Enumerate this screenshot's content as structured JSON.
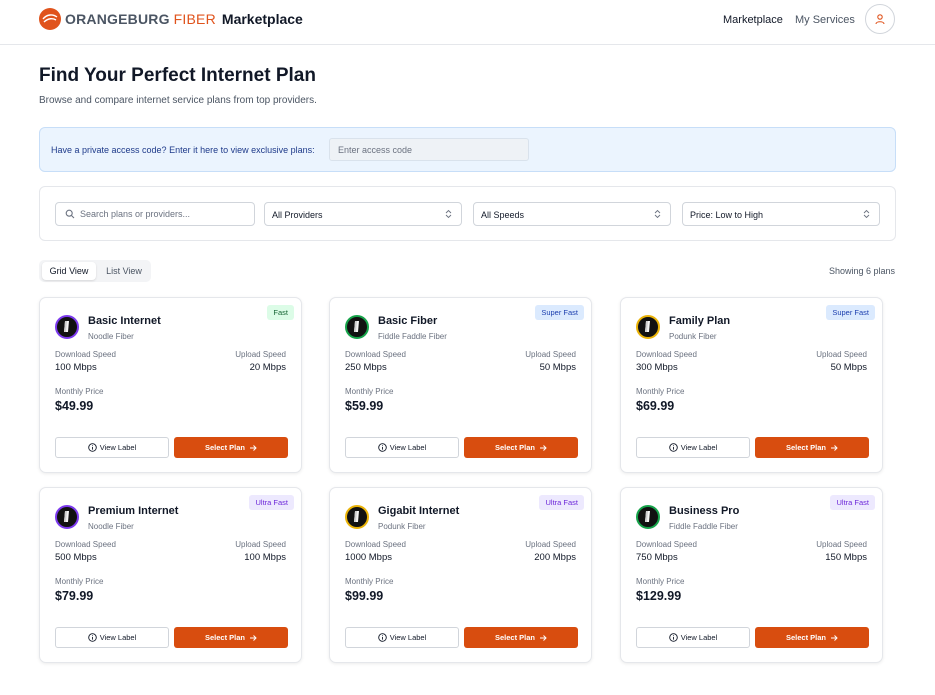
{
  "header": {
    "logo_word1": "ORANGEBURG",
    "logo_word2": "FIBER",
    "logo_word3": "Marketplace",
    "nav_marketplace": "Marketplace",
    "nav_services": "My Services",
    "brand_color": "#e0531c"
  },
  "main": {
    "title": "Find Your Perfect Internet Plan",
    "subtitle": "Browse and compare internet service plans from top providers."
  },
  "access": {
    "label": "Have a private access code? Enter it here to view exclusive plans:",
    "placeholder": "Enter access code"
  },
  "filters": {
    "search_placeholder": "Search plans or providers...",
    "provider": "All Providers",
    "speed": "All Speeds",
    "sort": "Price: Low to High"
  },
  "view": {
    "grid": "Grid View",
    "list": "List View",
    "showing": "Showing 6 plans"
  },
  "card_labels": {
    "download": "Download Speed",
    "upload": "Upload Speed",
    "monthly": "Monthly Price",
    "view_label": "View Label",
    "select": "Select Plan"
  },
  "plans": [
    {
      "name": "Basic Internet",
      "provider": "Noodle Fiber",
      "badge": "Fast",
      "badge_type": "fast",
      "ring": "#7c3aed",
      "download": "100 Mbps",
      "upload": "20 Mbps",
      "price": "$49.99"
    },
    {
      "name": "Basic Fiber",
      "provider": "Fiddle Faddle Fiber",
      "badge": "Super Fast",
      "badge_type": "super",
      "ring": "#16a34a",
      "download": "250 Mbps",
      "upload": "50 Mbps",
      "price": "$59.99"
    },
    {
      "name": "Family Plan",
      "provider": "Podunk Fiber",
      "badge": "Super Fast",
      "badge_type": "super",
      "ring": "#eab308",
      "download": "300 Mbps",
      "upload": "50 Mbps",
      "price": "$69.99"
    },
    {
      "name": "Premium Internet",
      "provider": "Noodle Fiber",
      "badge": "Ultra Fast",
      "badge_type": "ultra",
      "ring": "#7c3aed",
      "download": "500 Mbps",
      "upload": "100 Mbps",
      "price": "$79.99"
    },
    {
      "name": "Gigabit Internet",
      "provider": "Podunk Fiber",
      "badge": "Ultra Fast",
      "badge_type": "ultra",
      "ring": "#eab308",
      "download": "1000 Mbps",
      "upload": "200 Mbps",
      "price": "$99.99"
    },
    {
      "name": "Business Pro",
      "provider": "Fiddle Faddle Fiber",
      "badge": "Ultra Fast",
      "badge_type": "ultra",
      "ring": "#16a34a",
      "download": "750 Mbps",
      "upload": "150 Mbps",
      "price": "$129.99"
    }
  ]
}
